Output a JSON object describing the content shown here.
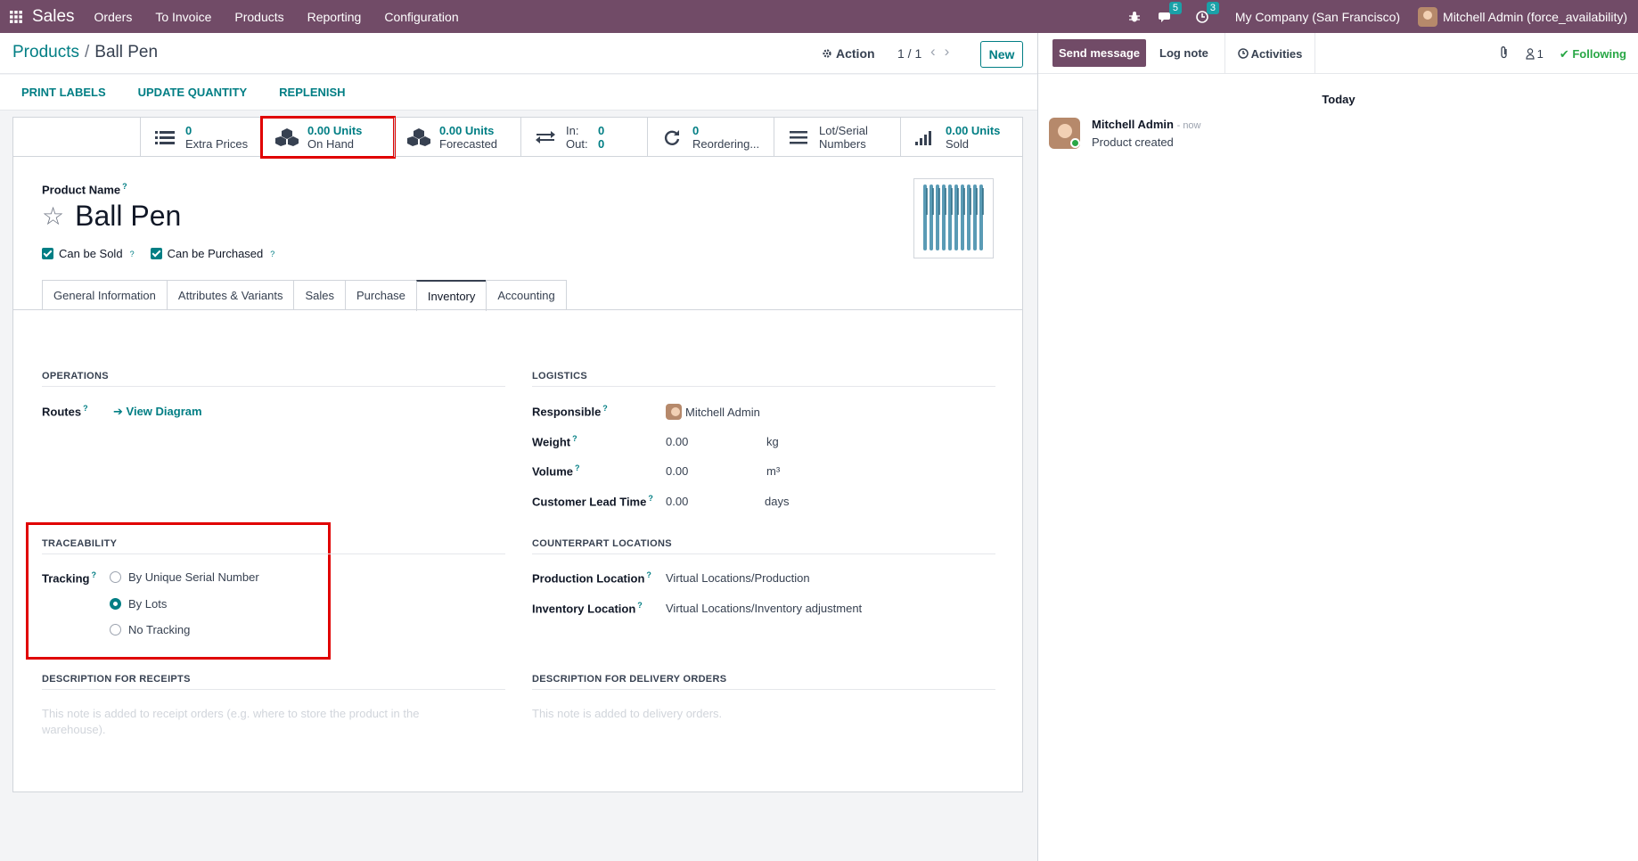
{
  "navbar": {
    "brand": "Sales",
    "menus": [
      "Orders",
      "To Invoice",
      "Products",
      "Reporting",
      "Configuration"
    ],
    "chat_badge": "5",
    "activity_badge": "3",
    "company": "My Company (San Francisco)",
    "user": "Mitchell Admin (force_availability)"
  },
  "control_panel": {
    "breadcrumb_parent": "Products",
    "breadcrumb_sep": "/",
    "breadcrumb_current": "Ball Pen",
    "action_label": "Action",
    "pager": "1 / 1",
    "new_label": "New"
  },
  "statusbar": {
    "buttons": [
      "PRINT LABELS",
      "UPDATE QUANTITY",
      "REPLENISH"
    ]
  },
  "smart_buttons": [
    {
      "value": "0",
      "label": "Extra Prices",
      "icon": "list-icon"
    },
    {
      "value": "0.00 Units",
      "label": "On Hand",
      "icon": "cubes-icon"
    },
    {
      "value": "0.00 Units",
      "label": "Forecasted",
      "icon": "cubes-icon"
    },
    {
      "in_label": "In:",
      "in_value": "0",
      "out_label": "Out:",
      "out_value": "0",
      "icon": "exchange-icon"
    },
    {
      "value": "0",
      "label": "Reordering...",
      "icon": "refresh-icon"
    },
    {
      "value": "Lot/Serial",
      "label": "Numbers",
      "icon": "bars-icon"
    },
    {
      "value": "0.00 Units",
      "label": "Sold",
      "icon": "signal-icon"
    }
  ],
  "product": {
    "name_label": "Product Name",
    "name": "Ball Pen",
    "can_be_sold": "Can be Sold",
    "can_be_purchased": "Can be Purchased"
  },
  "tabs": [
    "General Information",
    "Attributes & Variants",
    "Sales",
    "Purchase",
    "Inventory",
    "Accounting"
  ],
  "active_tab": "Inventory",
  "operations": {
    "title": "OPERATIONS",
    "routes_label": "Routes",
    "view_diagram": "View Diagram"
  },
  "logistics": {
    "title": "LOGISTICS",
    "responsible_label": "Responsible",
    "responsible": "Mitchell Admin",
    "weight_label": "Weight",
    "weight": "0.00",
    "weight_unit": "kg",
    "volume_label": "Volume",
    "volume": "0.00",
    "volume_unit": "m³",
    "lead_label": "Customer Lead Time",
    "lead": "0.00",
    "lead_unit": "days"
  },
  "traceability": {
    "title": "TRACEABILITY",
    "tracking_label": "Tracking",
    "options": [
      "By Unique Serial Number",
      "By Lots",
      "No Tracking"
    ],
    "selected": "By Lots"
  },
  "counterpart": {
    "title": "COUNTERPART LOCATIONS",
    "production_label": "Production Location",
    "production": "Virtual Locations/Production",
    "inventory_label": "Inventory Location",
    "inventory": "Virtual Locations/Inventory adjustment"
  },
  "desc_receipts": {
    "title": "DESCRIPTION FOR RECEIPTS",
    "placeholder": "This note is added to receipt orders (e.g. where to store the product in the warehouse)."
  },
  "desc_delivery": {
    "title": "DESCRIPTION FOR DELIVERY ORDERS",
    "placeholder": "This note is added to delivery orders."
  },
  "chatter": {
    "send_message": "Send message",
    "log_note": "Log note",
    "activities": "Activities",
    "followers_count": "1",
    "following": "Following",
    "today": "Today",
    "author": "Mitchell Admin",
    "time": "- now",
    "body": "Product created"
  },
  "colors": {
    "brand": "#714b67",
    "accent": "#017e84",
    "highlight": "#e00000",
    "following": "#28a745"
  }
}
